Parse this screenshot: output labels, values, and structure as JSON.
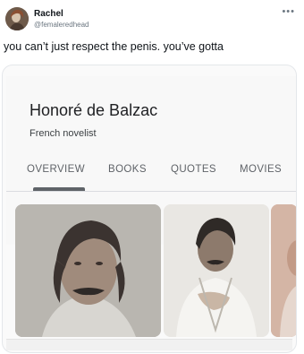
{
  "tweet": {
    "author_name": "Rachel",
    "author_handle": "@femaleredhead",
    "text": "you can’t just respect the penis. you’ve gotta",
    "more_icon": "more-horizontal-icon"
  },
  "knowledge_card": {
    "title": "Honoré de Balzac",
    "subtitle": "French novelist",
    "tabs": [
      {
        "label": "OVERVIEW",
        "selected": true
      },
      {
        "label": "BOOKS",
        "selected": false
      },
      {
        "label": "QUOTES",
        "selected": false
      },
      {
        "label": "MOVIES",
        "selected": false
      }
    ]
  },
  "colors": {
    "text_primary": "#0f1419",
    "text_secondary": "#6b7680",
    "tab_text": "#5f6368",
    "card_bg": "#f8f8f8"
  }
}
